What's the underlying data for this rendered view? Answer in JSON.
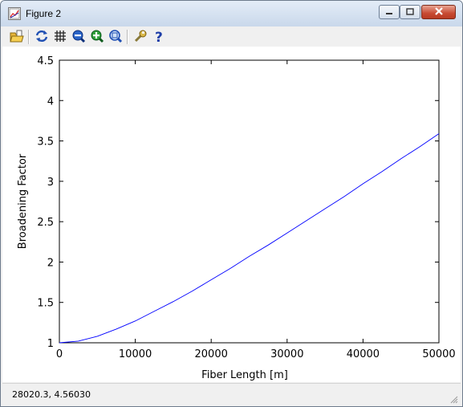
{
  "window": {
    "title": "Figure 2",
    "controls": {
      "minimize": "minimize",
      "maximize": "maximize",
      "close": "close"
    }
  },
  "toolbar": {
    "buttons": [
      {
        "name": "open-file-icon",
        "tooltip": ""
      },
      {
        "name": "refresh-icon",
        "tooltip": ""
      },
      {
        "name": "grid-icon",
        "tooltip": ""
      },
      {
        "name": "zoom-out-icon",
        "tooltip": ""
      },
      {
        "name": "zoom-in-icon",
        "tooltip": ""
      },
      {
        "name": "zoom-fit-icon",
        "tooltip": ""
      },
      {
        "name": "wrench-icon",
        "tooltip": ""
      },
      {
        "name": "help-icon",
        "tooltip": ""
      }
    ]
  },
  "status": {
    "coordinates": "28020.3,  4.56030"
  },
  "chart_data": {
    "type": "line",
    "title": "",
    "xlabel": "Fiber Length [m]",
    "ylabel": "Broadening Factor",
    "xlim": [
      0,
      50000
    ],
    "ylim": [
      1,
      4.5
    ],
    "xticks": [
      0,
      10000,
      20000,
      30000,
      40000,
      50000
    ],
    "xtick_labels": [
      "0",
      "10000",
      "20000",
      "30000",
      "40000",
      "50000"
    ],
    "yticks": [
      1,
      1.5,
      2,
      2.5,
      3,
      3.5,
      4,
      4.5
    ],
    "ytick_labels": [
      "1",
      "1.5",
      "2",
      "2.5",
      "3",
      "3.5",
      "4",
      "4.5"
    ],
    "grid": false,
    "series": [
      {
        "color": "#0000ff",
        "x": [
          0,
          2500,
          5000,
          7500,
          10000,
          12500,
          15000,
          17500,
          20000,
          22500,
          25000,
          27500,
          30000,
          32500,
          35000,
          37500,
          40000,
          42500,
          45000,
          47500,
          50000
        ],
        "y": [
          1.0,
          1.02,
          1.08,
          1.17,
          1.27,
          1.39,
          1.51,
          1.64,
          1.78,
          1.92,
          2.07,
          2.21,
          2.36,
          2.51,
          2.66,
          2.81,
          2.97,
          3.12,
          3.28,
          3.43,
          3.59
        ]
      }
    ]
  }
}
